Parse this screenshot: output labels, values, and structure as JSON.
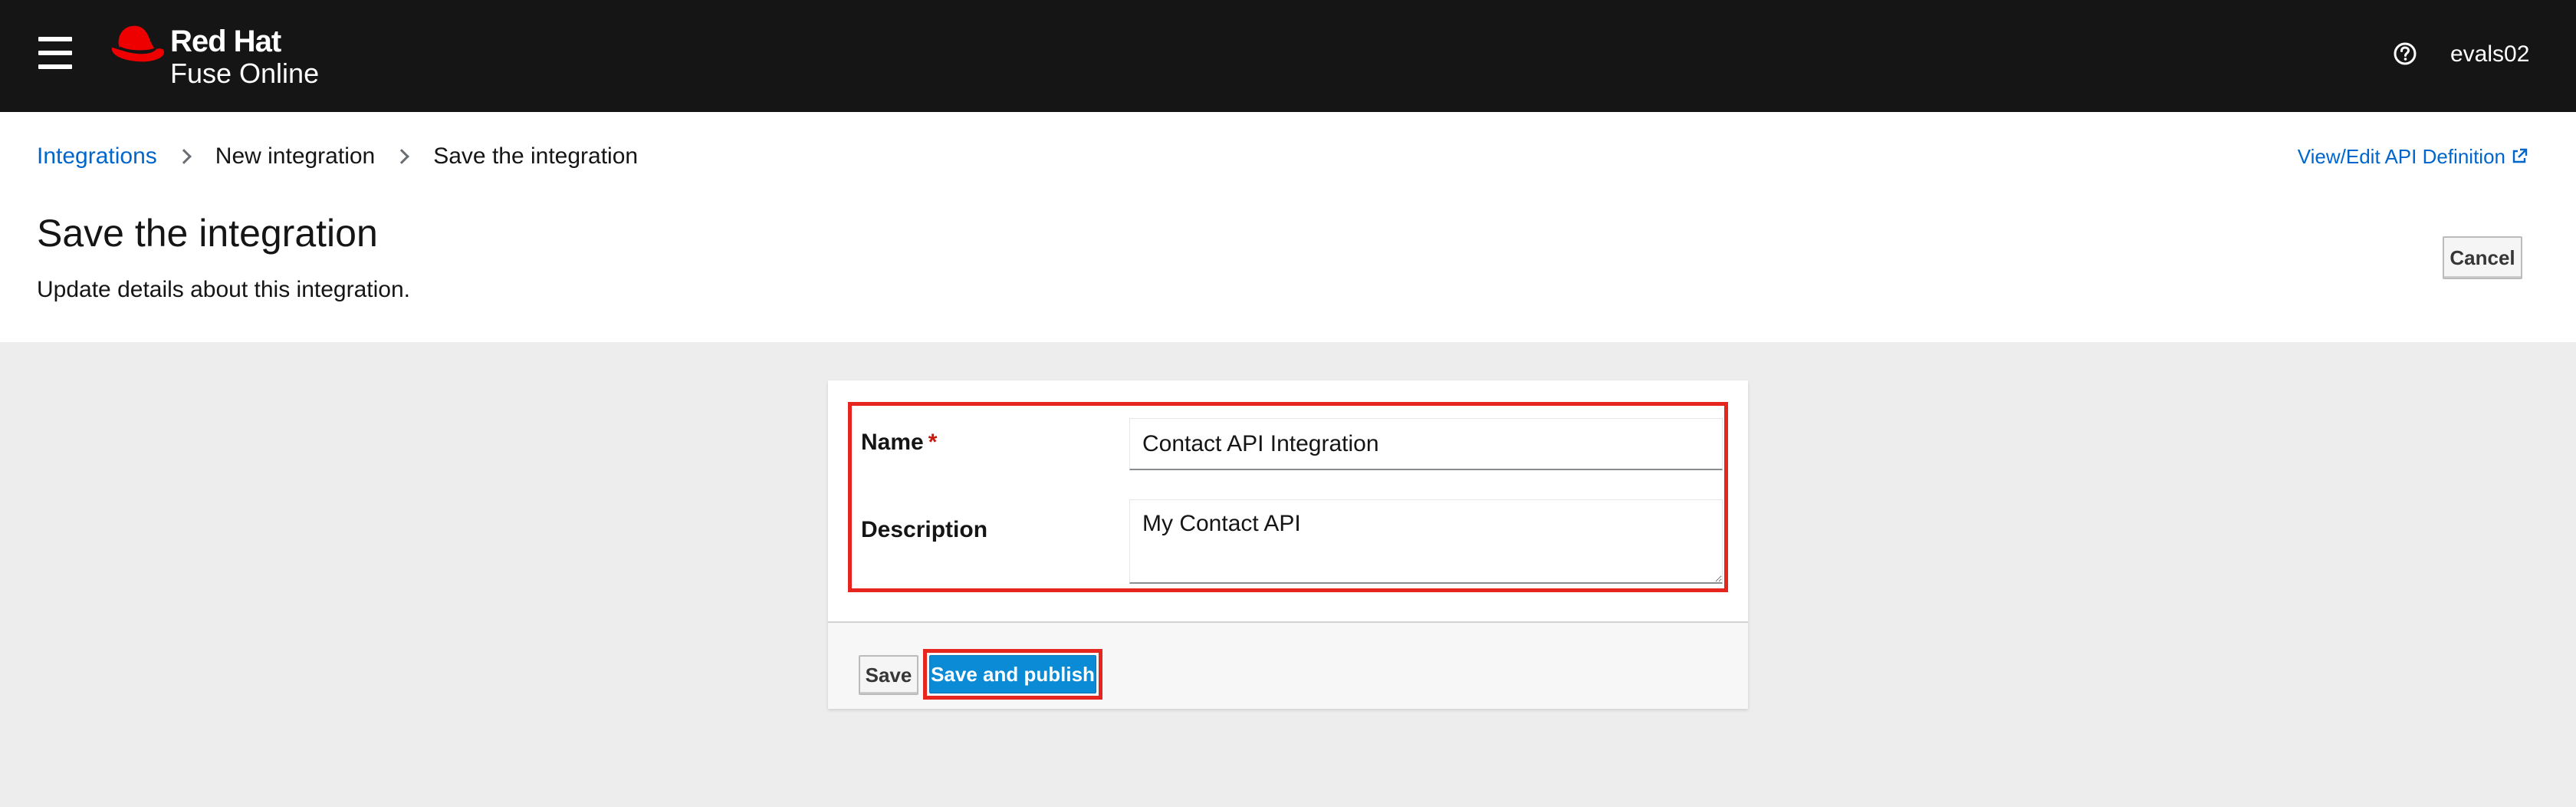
{
  "masthead": {
    "brand_line1": "Red Hat",
    "brand_line2": "Fuse Online",
    "user": "evals02",
    "icons": {
      "menu": "hamburger-icon",
      "help": "question-circle-icon",
      "logo": "redhat-hat-icon"
    },
    "colors": {
      "background": "#151515",
      "logo_red": "#ee0000"
    }
  },
  "breadcrumb": {
    "items": [
      "Integrations",
      "New integration",
      "Save the integration"
    ]
  },
  "header": {
    "api_link": "View/Edit API Definition",
    "title": "Save the integration",
    "subtitle": "Update details about this integration.",
    "cancel_label": "Cancel"
  },
  "form": {
    "name_label": "Name",
    "required_mark": "*",
    "name_value": "Contact API Integration",
    "description_label": "Description",
    "description_value": "My Contact API"
  },
  "footer": {
    "save_label": "Save",
    "publish_label": "Save and publish"
  },
  "colors": {
    "link": "#0066cc",
    "primary_button": "#0b8bd6",
    "highlight": "#e6251f",
    "page_background": "#ededed"
  }
}
